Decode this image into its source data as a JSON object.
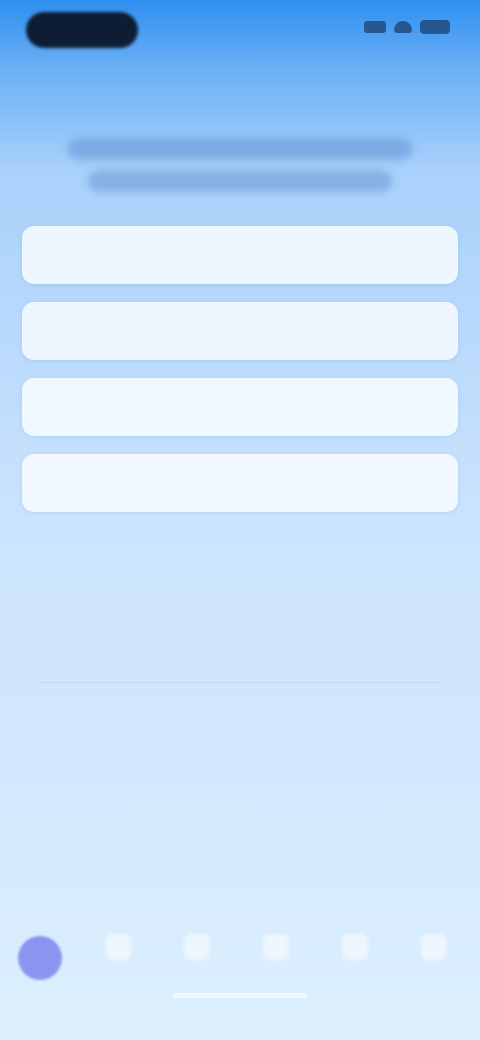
{
  "status_bar": {
    "time": "",
    "icons": [
      "signal-icon",
      "wifi-icon",
      "battery-icon"
    ]
  },
  "header": {
    "back_label": "",
    "action_label": "",
    "title": ""
  },
  "form": {
    "fields": [
      {
        "value": "",
        "placeholder": ""
      },
      {
        "value": "",
        "placeholder": ""
      },
      {
        "value": "",
        "placeholder": ""
      },
      {
        "value": "",
        "placeholder": ""
      }
    ]
  },
  "bottom_nav": {
    "avatar_color": "#8c96f2",
    "items": [
      {
        "icon": "nav-icon",
        "label": ""
      },
      {
        "icon": "nav-icon",
        "label": ""
      },
      {
        "icon": "nav-icon",
        "label": ""
      },
      {
        "icon": "nav-icon",
        "label": ""
      },
      {
        "icon": "nav-icon",
        "label": ""
      }
    ]
  },
  "colors": {
    "gradient_top": "#2e8ff0",
    "gradient_mid": "#cbe3fd",
    "gradient_bottom": "#dbeffe",
    "field_background": "#f3f9ff",
    "status_pill": "#0e1d33"
  }
}
